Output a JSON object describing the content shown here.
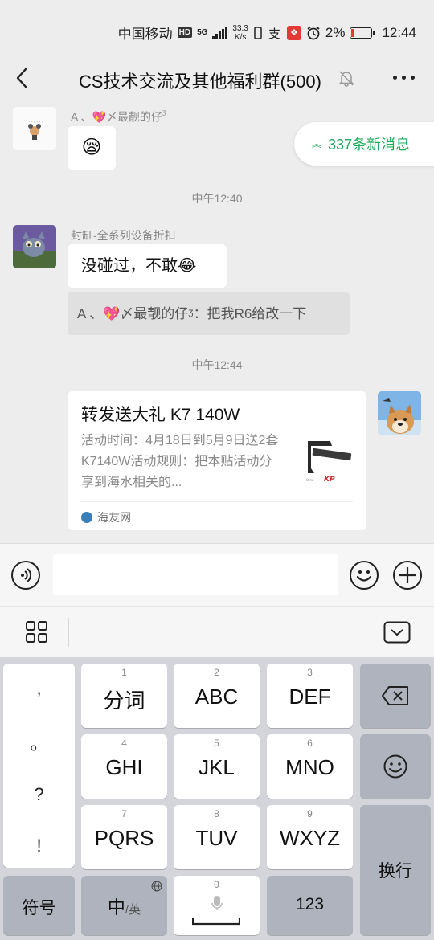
{
  "status_bar": {
    "carrier": "中国移动",
    "hd": "HD",
    "network": "5G",
    "speed_value": "33.3",
    "speed_unit": "K/s",
    "battery_percent": "2%",
    "time": "12:44"
  },
  "nav": {
    "title": "CS技术交流及其他福利群(500)"
  },
  "new_messages": "337条新消息",
  "messages": {
    "m1_sender": "A 、💖〆最靓的仔",
    "m1_sender_sup": "ᶾ",
    "m1_text": "😪",
    "time1": "中午12:40",
    "m2_sender": "封缸-全系列设备折扣",
    "m2_text": "没碰过，不敢😂",
    "m2_quote": "A 、💖〆最靓的仔ᶾ：把我R6给改一下",
    "time2": "中午12:44",
    "card_title": "转发送大礼 K7 140W",
    "card_desc": "活动时间：4月18日到5月9日送2套K7140W活动规则：把本贴活动分享到海水相关的...",
    "card_source": "海友网"
  },
  "keyboard": {
    "punct": [
      ",",
      "。",
      "?",
      "!"
    ],
    "keys": [
      {
        "num": "1",
        "label": "分词"
      },
      {
        "num": "2",
        "label": "ABC"
      },
      {
        "num": "3",
        "label": "DEF"
      },
      {
        "num": "4",
        "label": "GHI"
      },
      {
        "num": "5",
        "label": "JKL"
      },
      {
        "num": "6",
        "label": "MNO"
      },
      {
        "num": "7",
        "label": "PQRS"
      },
      {
        "num": "8",
        "label": "TUV"
      },
      {
        "num": "9",
        "label": "WXYZ"
      }
    ],
    "symbol": "符号",
    "lang_main": "中",
    "lang_sub": "/英",
    "space_num": "0",
    "numeric": "123",
    "enter": "换行"
  },
  "colors": {
    "accent_green": "#1aad5a",
    "chat_bg": "#ededed",
    "keyboard_bg": "#d3d5da",
    "function_key": "#aeb3bd"
  }
}
